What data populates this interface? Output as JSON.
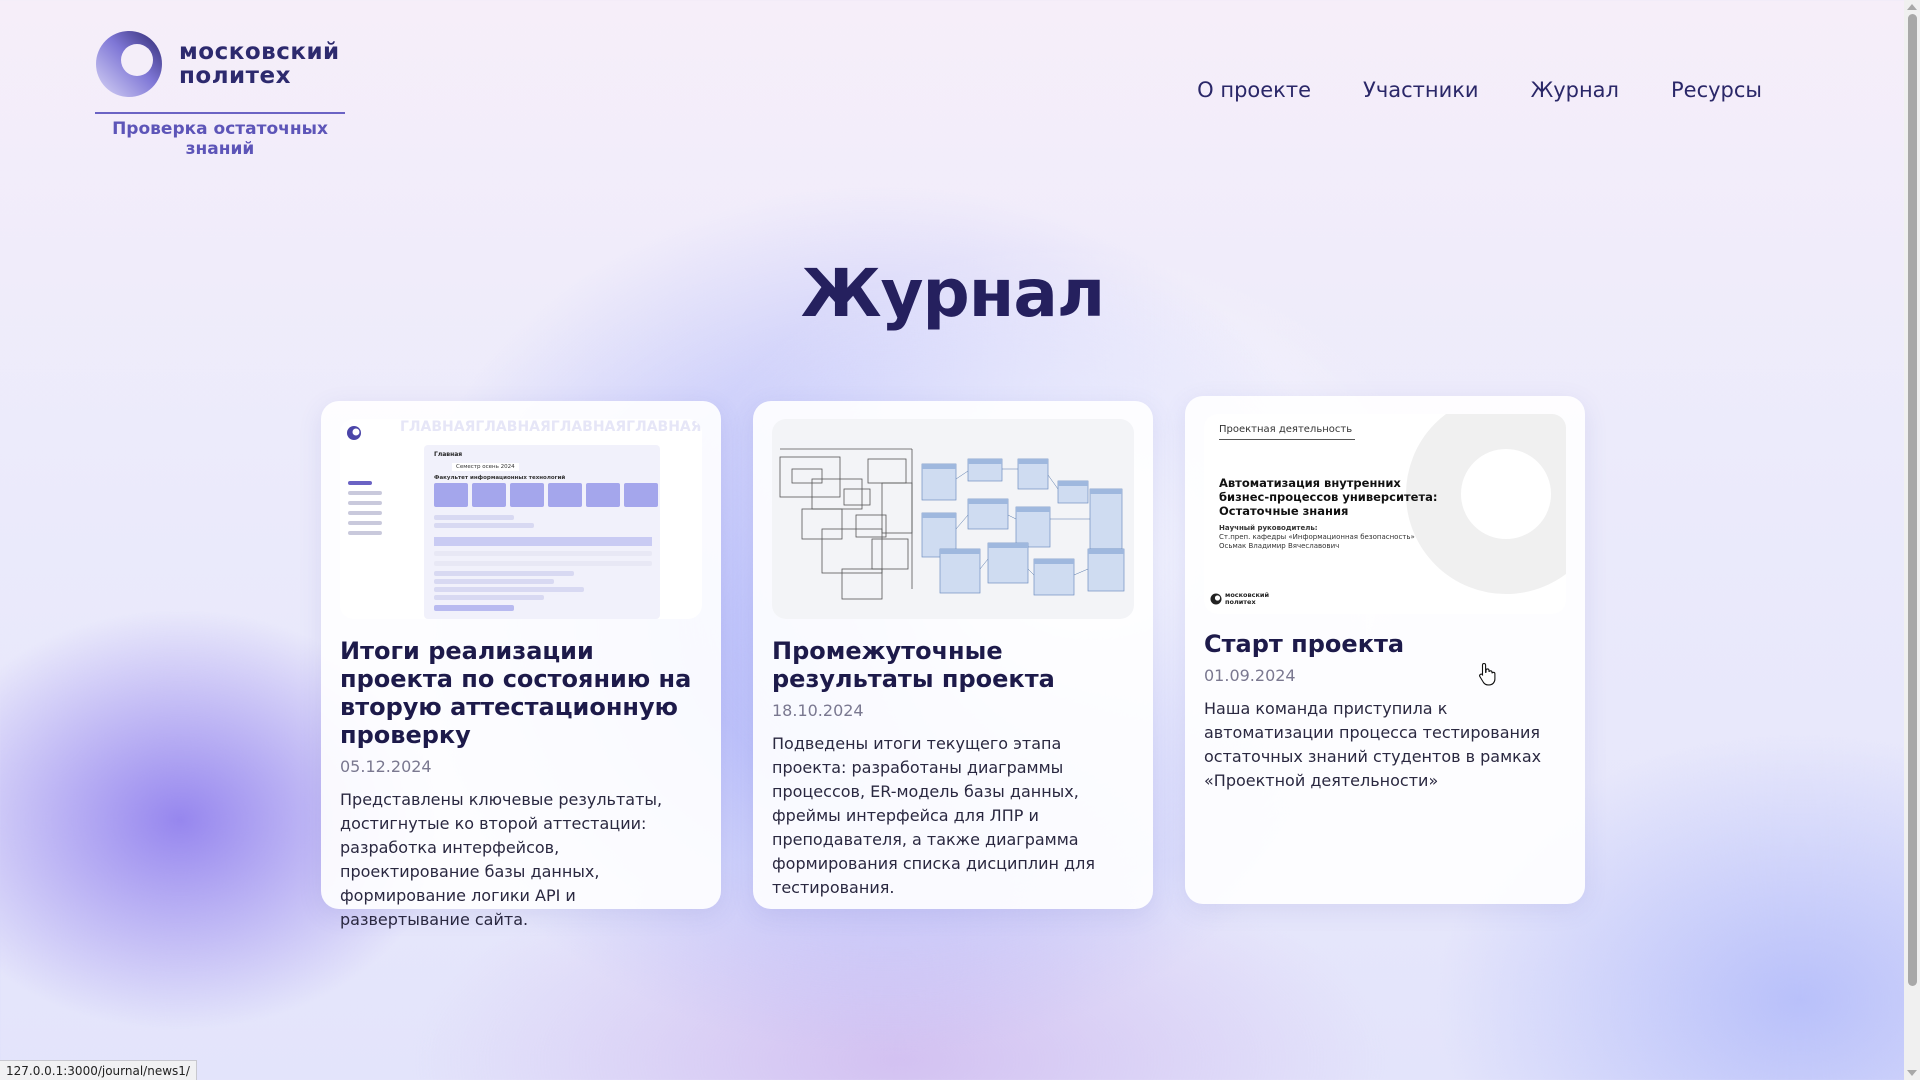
{
  "brand": {
    "name_line1": "московский",
    "name_line2": "политех",
    "subtitle_line1": "Проверка остаточных",
    "subtitle_line2": "знаний"
  },
  "nav": [
    {
      "label": "О проекте"
    },
    {
      "label": "Участники"
    },
    {
      "label": "Журнал"
    },
    {
      "label": "Ресурсы"
    }
  ],
  "page": {
    "title": "Журнал"
  },
  "cards": [
    {
      "title": "Итоги реализации проекта по состоянию на вторую аттестационную проверку",
      "date": "05.12.2024",
      "description": "Представлены ключевые результаты, достигнутые ко второй аттестации: разработка интерфейсов, проектирование базы данных, формирование логики API и развертывание сайта.",
      "thumb": {
        "marquee": "ГЛАВНАЯГЛАВНАЯГЛАВНАЯГЛАВНАЯГЛАВ",
        "heading": "Главная",
        "semester": "Семестр  осень 2024",
        "faculty": "Факультет информационных технологий"
      }
    },
    {
      "title": "Промежуточные результаты проекта",
      "date": "18.10.2024",
      "description": "Подведены итоги текущего этапа проекта: разработаны диаграммы процессов, ER-модель базы данных, фреймы интерфейса для ЛПР и преподавателя, а также диаграмма формирования списка дисциплин для тестирования."
    },
    {
      "title": "Старт проекта",
      "date": "01.09.2024",
      "description": "Наша команда приступила к автоматизации процесса тестирования остаточных знаний студентов в рамках «Проектной деятельности»",
      "thumb": {
        "tag": "Проектная деятельность",
        "slide_title": "Автоматизация внутренних бизнес-процессов университета: Остаточные знания",
        "supervisor_label": "Научный руководитель:",
        "supervisor_role": "Ст.преп. кафедры «Информационная безопасность»",
        "supervisor_name": "Осьмак Владимир Вячеславович",
        "logo_line1": "московский",
        "logo_line2": "политех"
      }
    }
  ],
  "status_bar": {
    "url": "127.0.0.1:3000/journal/news1/"
  },
  "colors": {
    "brand_dark": "#25205e",
    "brand_accent": "#5d55b8",
    "thumb_accent": "#a4a6ec",
    "diagram_blue": "#9fb8de"
  },
  "icons": [
    "politech-logo-icon",
    "pointer-hand-icon"
  ]
}
